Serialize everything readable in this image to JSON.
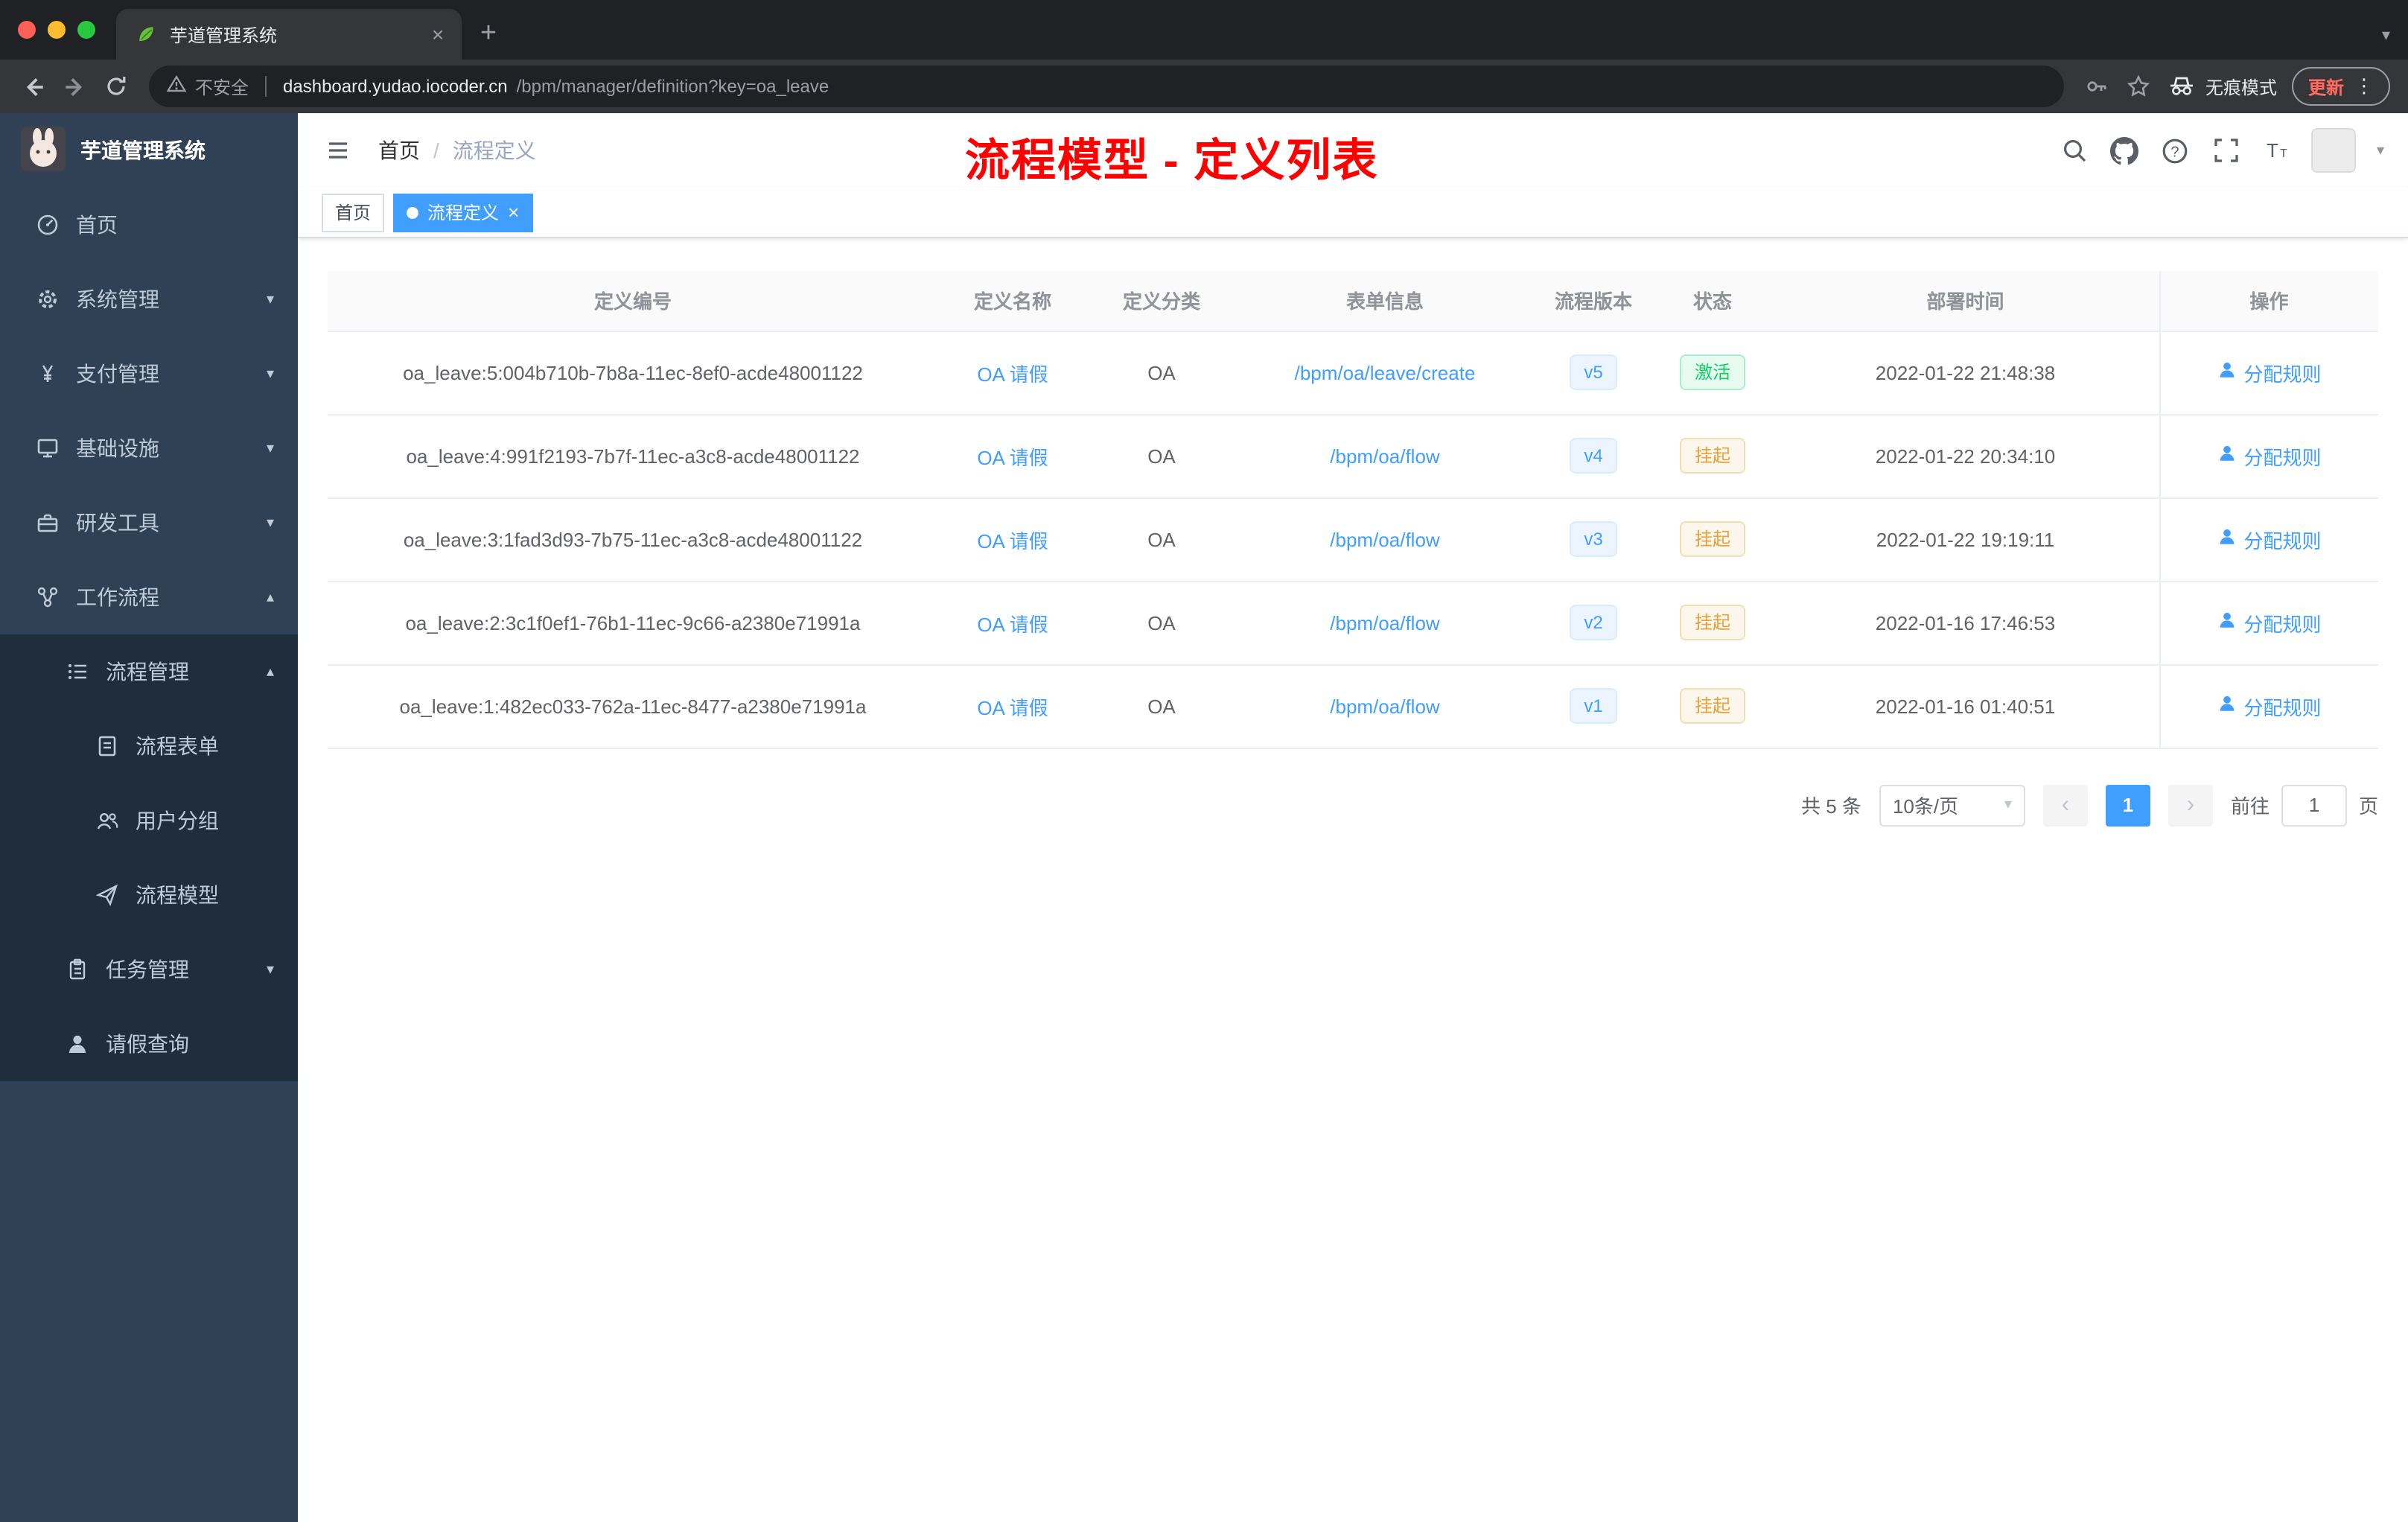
{
  "browser": {
    "tab_title": "芋道管理系统",
    "security_label": "不安全",
    "url_host": "dashboard.yudao.iocoder.cn",
    "url_path": "/bpm/manager/definition?key=oa_leave",
    "incognito_label": "无痕模式",
    "update_label": "更新"
  },
  "sidebar": {
    "title": "芋道管理系统",
    "items": {
      "home": "首页",
      "system": "系统管理",
      "payment": "支付管理",
      "infra": "基础设施",
      "devtools": "研发工具",
      "workflow": "工作流程",
      "process_mgmt": "流程管理",
      "process_form": "流程表单",
      "user_group": "用户分组",
      "process_model": "流程模型",
      "task_mgmt": "任务管理",
      "leave_query": "请假查询"
    }
  },
  "navbar": {
    "breadcrumb_home": "首页",
    "breadcrumb_sep": "/",
    "breadcrumb_current": "流程定义",
    "annotation": "流程模型 - 定义列表"
  },
  "tags": {
    "home": "首页",
    "active": "流程定义"
  },
  "table": {
    "columns": [
      "定义编号",
      "定义名称",
      "定义分类",
      "表单信息",
      "流程版本",
      "状态",
      "部署时间",
      "操作"
    ],
    "rows": [
      {
        "id": "oa_leave:5:004b710b-7b8a-11ec-8ef0-acde48001122",
        "name": "OA 请假",
        "category": "OA",
        "form": "/bpm/oa/leave/create",
        "version": "v5",
        "status": "激活",
        "status_type": "success",
        "time": "2022-01-22 21:48:38",
        "action": "分配规则"
      },
      {
        "id": "oa_leave:4:991f2193-7b7f-11ec-a3c8-acde48001122",
        "name": "OA 请假",
        "category": "OA",
        "form": "/bpm/oa/flow",
        "version": "v4",
        "status": "挂起",
        "status_type": "warning",
        "time": "2022-01-22 20:34:10",
        "action": "分配规则"
      },
      {
        "id": "oa_leave:3:1fad3d93-7b75-11ec-a3c8-acde48001122",
        "name": "OA 请假",
        "category": "OA",
        "form": "/bpm/oa/flow",
        "version": "v3",
        "status": "挂起",
        "status_type": "warning",
        "time": "2022-01-22 19:19:11",
        "action": "分配规则"
      },
      {
        "id": "oa_leave:2:3c1f0ef1-76b1-11ec-9c66-a2380e71991a",
        "name": "OA 请假",
        "category": "OA",
        "form": "/bpm/oa/flow",
        "version": "v2",
        "status": "挂起",
        "status_type": "warning",
        "time": "2022-01-16 17:46:53",
        "action": "分配规则"
      },
      {
        "id": "oa_leave:1:482ec033-762a-11ec-8477-a2380e71991a",
        "name": "OA 请假",
        "category": "OA",
        "form": "/bpm/oa/flow",
        "version": "v1",
        "status": "挂起",
        "status_type": "warning",
        "time": "2022-01-16 01:40:51",
        "action": "分配规则"
      }
    ]
  },
  "pagination": {
    "total": "共 5 条",
    "page_size": "10条/页",
    "current_page": "1",
    "goto_label": "前往",
    "goto_value": "1",
    "unit_label": "页"
  },
  "glyphs": {
    "close": "×",
    "new_tab": "+",
    "more_vertical": "⋮",
    "caret_down": "▾",
    "caret_up": "▴",
    "prev": "‹",
    "next": "›"
  },
  "colors": {
    "accent": "#409eff",
    "success": "#13ce66",
    "warning": "#e6a23c",
    "annotation": "#ff0000",
    "sidebar_bg": "#304156",
    "submenu_bg": "#1f2d3d"
  }
}
